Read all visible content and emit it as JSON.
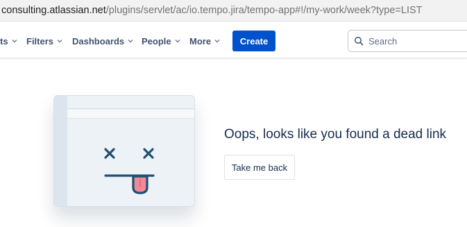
{
  "browser": {
    "url_host": "consulting.atlassian.net",
    "url_path": "/plugins/servlet/ac/io.tempo.jira/tempo-app#!/my-work/week?type=LIST"
  },
  "nav": {
    "items": [
      {
        "label": "ts"
      },
      {
        "label": "Filters"
      },
      {
        "label": "Dashboards"
      },
      {
        "label": "People"
      },
      {
        "label": "More"
      }
    ],
    "create_label": "Create",
    "search_placeholder": "Search"
  },
  "error": {
    "message": "Oops, looks like you found a dead link",
    "back_label": "Take me back"
  },
  "colors": {
    "primary": "#0052cc",
    "text": "#172b4d",
    "tongue": "#f08a96"
  }
}
